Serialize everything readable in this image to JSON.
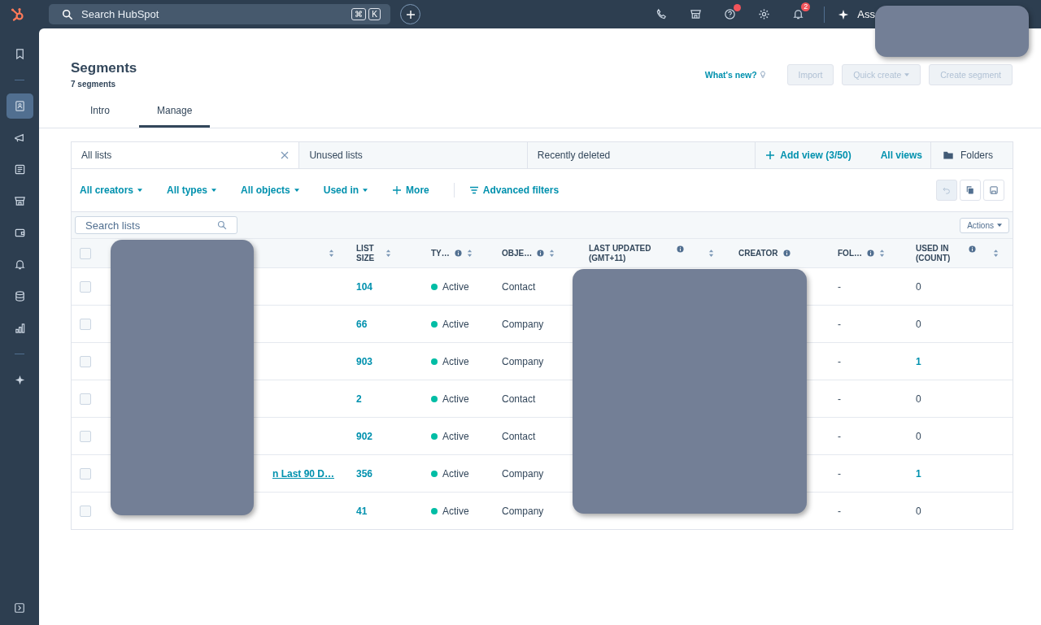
{
  "top_bar": {
    "search": {
      "placeholder": "Search HubSpot",
      "shortcut": [
        "⌘",
        "K"
      ]
    },
    "icons": [
      {
        "kind": "phone"
      },
      {
        "kind": "store"
      },
      {
        "kind": "help",
        "dot": true
      },
      {
        "kind": "gear"
      },
      {
        "kind": "bell",
        "badge": "2"
      }
    ],
    "assistant": "Ass"
  },
  "sidebar": {
    "groups": [
      {
        "items": [
          {
            "kind": "bookmark",
            "selected": false
          }
        ]
      },
      {
        "items": [
          {
            "kind": "contacts",
            "selected": true
          },
          {
            "kind": "megaphone",
            "selected": false
          },
          {
            "kind": "document",
            "selected": false
          },
          {
            "kind": "store",
            "selected": false
          },
          {
            "kind": "wallet",
            "selected": false
          },
          {
            "kind": "bell",
            "selected": false
          },
          {
            "kind": "database",
            "selected": false
          },
          {
            "kind": "chart",
            "selected": false
          }
        ]
      },
      {
        "items": [
          {
            "kind": "sparkle",
            "selected": false
          }
        ]
      }
    ]
  },
  "header": {
    "title": "Segments",
    "count": "7 segments",
    "whats_new": "What's new?",
    "buttons": [
      {
        "label": "Import",
        "disabled": true,
        "caret": false
      },
      {
        "label": "Quick create",
        "disabled": true,
        "caret": true
      },
      {
        "label": "Create segment",
        "disabled": true,
        "caret": false
      }
    ]
  },
  "tabs": [
    {
      "label": "Intro",
      "selected": false
    },
    {
      "label": "Manage",
      "selected": true
    }
  ],
  "views": [
    {
      "label": "All lists",
      "selected": true
    },
    {
      "label": "Unused lists",
      "selected": false
    },
    {
      "label": "Recently deleted",
      "selected": false
    }
  ],
  "add_view": "Add view (3/50)",
  "all_views": "All views",
  "folders": "Folders",
  "filters": [
    {
      "label": "All creators",
      "kind": "dropdown"
    },
    {
      "label": "All types",
      "kind": "dropdown"
    },
    {
      "label": "All objects",
      "kind": "dropdown"
    },
    {
      "label": "Used in",
      "kind": "dropdown"
    },
    {
      "label": "More",
      "kind": "plus"
    },
    {
      "label": "Advanced filters",
      "kind": "advanced"
    }
  ],
  "tools": [
    {
      "kind": "undo",
      "disabled": true
    },
    {
      "kind": "copy",
      "disabled": false
    },
    {
      "kind": "save",
      "disabled": false
    }
  ],
  "search_lists": {
    "placeholder": "Search lists"
  },
  "actions": "Actions",
  "table": {
    "header_checked": false,
    "columns": [
      {
        "sortable": true,
        "info": false
      },
      {
        "label": "LIST\nSIZE",
        "sortable": true,
        "info": false
      },
      {
        "label": "TY…",
        "sortable": true,
        "info": true
      },
      {
        "label": "OBJE…",
        "sortable": true,
        "info": true
      },
      {
        "label": "LAST UPDATED\n(GMT+11)",
        "sortable": true,
        "info": true
      },
      {
        "label": "CREATOR",
        "sortable": false,
        "info": true
      },
      {
        "label": "FOL…",
        "sortable": true,
        "info": true
      },
      {
        "label": "USED IN\n(COUNT)",
        "sortable": true,
        "info": true
      }
    ],
    "rows": [
      {
        "checked": false,
        "size": "104",
        "status": "Active",
        "object": "Contact",
        "folder": "-",
        "used_in": "0",
        "used_link": false
      },
      {
        "checked": false,
        "size": "66",
        "status": "Active",
        "object": "Company",
        "folder": "-",
        "used_in": "0",
        "used_link": false
      },
      {
        "checked": false,
        "size": "903",
        "status": "Active",
        "object": "Company",
        "folder": "-",
        "used_in": "1",
        "used_link": true
      },
      {
        "checked": false,
        "size": "2",
        "status": "Active",
        "object": "Contact",
        "folder": "-",
        "used_in": "0",
        "used_link": false
      },
      {
        "checked": false,
        "size": "902",
        "status": "Active",
        "object": "Contact",
        "folder": "-",
        "used_in": "0",
        "used_link": false
      },
      {
        "checked": false,
        "name": "n Last 90 D…",
        "size": "356",
        "status": "Active",
        "object": "Company",
        "folder": "-",
        "used_in": "1",
        "used_link": true
      },
      {
        "checked": false,
        "size": "41",
        "status": "Active",
        "object": "Company",
        "folder": "-",
        "used_in": "0",
        "used_link": false
      }
    ]
  }
}
